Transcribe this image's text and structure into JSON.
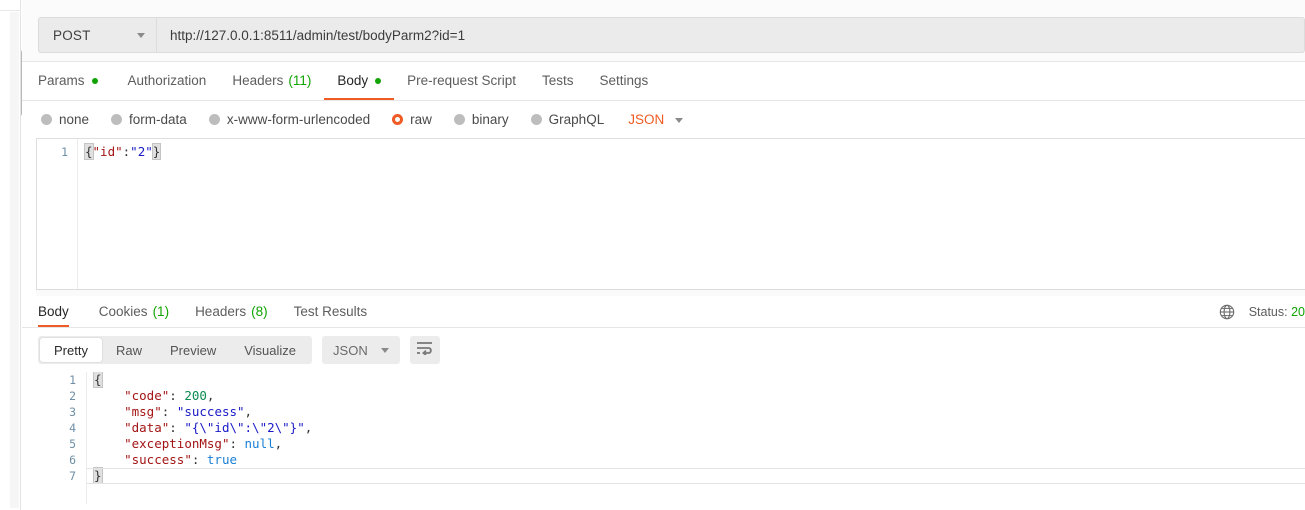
{
  "request": {
    "method": "POST",
    "url": "http://127.0.0.1:8511/admin/test/bodyParm2?id=1",
    "tabs": [
      {
        "label": "Params",
        "dot": true,
        "count": null,
        "active": false
      },
      {
        "label": "Authorization",
        "dot": false,
        "count": null,
        "active": false
      },
      {
        "label": "Headers",
        "dot": false,
        "count": "(11)",
        "active": false
      },
      {
        "label": "Body",
        "dot": true,
        "count": null,
        "active": true
      },
      {
        "label": "Pre-request Script",
        "dot": false,
        "count": null,
        "active": false
      },
      {
        "label": "Tests",
        "dot": false,
        "count": null,
        "active": false
      },
      {
        "label": "Settings",
        "dot": false,
        "count": null,
        "active": false
      }
    ],
    "body_types": [
      {
        "label": "none",
        "selected": false
      },
      {
        "label": "form-data",
        "selected": false
      },
      {
        "label": "x-www-form-urlencoded",
        "selected": false
      },
      {
        "label": "raw",
        "selected": true
      },
      {
        "label": "binary",
        "selected": false
      },
      {
        "label": "GraphQL",
        "selected": false
      }
    ],
    "raw_format": "JSON",
    "editor": {
      "line_numbers": [
        "1"
      ],
      "line1": {
        "open_brace": "{",
        "key": "\"id\"",
        "colon": ":",
        "value": "\"2\"",
        "close_brace": "}"
      }
    }
  },
  "response": {
    "tabs": [
      {
        "label": "Body",
        "count": null,
        "active": true
      },
      {
        "label": "Cookies",
        "count": "(1)",
        "active": false
      },
      {
        "label": "Headers",
        "count": "(8)",
        "active": false
      },
      {
        "label": "Test Results",
        "count": null,
        "active": false
      }
    ],
    "status_prefix": "Status:",
    "status_code": "20",
    "view_modes": [
      {
        "label": "Pretty",
        "active": true
      },
      {
        "label": "Raw",
        "active": false
      },
      {
        "label": "Preview",
        "active": false
      },
      {
        "label": "Visualize",
        "active": false
      }
    ],
    "format": "JSON",
    "editor": {
      "line_numbers": [
        "1",
        "2",
        "3",
        "4",
        "5",
        "6",
        "7"
      ],
      "lines": [
        {
          "indent": "",
          "segments": [
            {
              "t": "{",
              "c": "brace-match"
            }
          ]
        },
        {
          "indent": "    ",
          "segments": [
            {
              "t": "\"code\"",
              "c": "tk-key"
            },
            {
              "t": ": ",
              "c": "tk-punct"
            },
            {
              "t": "200",
              "c": "tk-num"
            },
            {
              "t": ",",
              "c": "tk-punct"
            }
          ]
        },
        {
          "indent": "    ",
          "segments": [
            {
              "t": "\"msg\"",
              "c": "tk-key"
            },
            {
              "t": ": ",
              "c": "tk-punct"
            },
            {
              "t": "\"success\"",
              "c": "tk-str"
            },
            {
              "t": ",",
              "c": "tk-punct"
            }
          ]
        },
        {
          "indent": "    ",
          "segments": [
            {
              "t": "\"data\"",
              "c": "tk-key"
            },
            {
              "t": ": ",
              "c": "tk-punct"
            },
            {
              "t": "\"{\\\"id\\\":\\\"2\\\"}\"",
              "c": "tk-str"
            },
            {
              "t": ",",
              "c": "tk-punct"
            }
          ]
        },
        {
          "indent": "    ",
          "segments": [
            {
              "t": "\"exceptionMsg\"",
              "c": "tk-key"
            },
            {
              "t": ": ",
              "c": "tk-punct"
            },
            {
              "t": "null",
              "c": "tk-lit"
            },
            {
              "t": ",",
              "c": "tk-punct"
            }
          ]
        },
        {
          "indent": "    ",
          "segments": [
            {
              "t": "\"success\"",
              "c": "tk-key"
            },
            {
              "t": ": ",
              "c": "tk-punct"
            },
            {
              "t": "true",
              "c": "tk-lit"
            }
          ]
        },
        {
          "indent": "",
          "segments": [
            {
              "t": "}",
              "c": "brace-match"
            }
          ]
        }
      ]
    }
  },
  "colors": {
    "accent_orange": "#ef5b25",
    "status_green": "#10a402",
    "json_key_red": "#a31515",
    "json_string_blue": "#1a1ac8",
    "json_number_green": "#0e8a4f",
    "json_literal_blue": "#1a7fd4"
  }
}
